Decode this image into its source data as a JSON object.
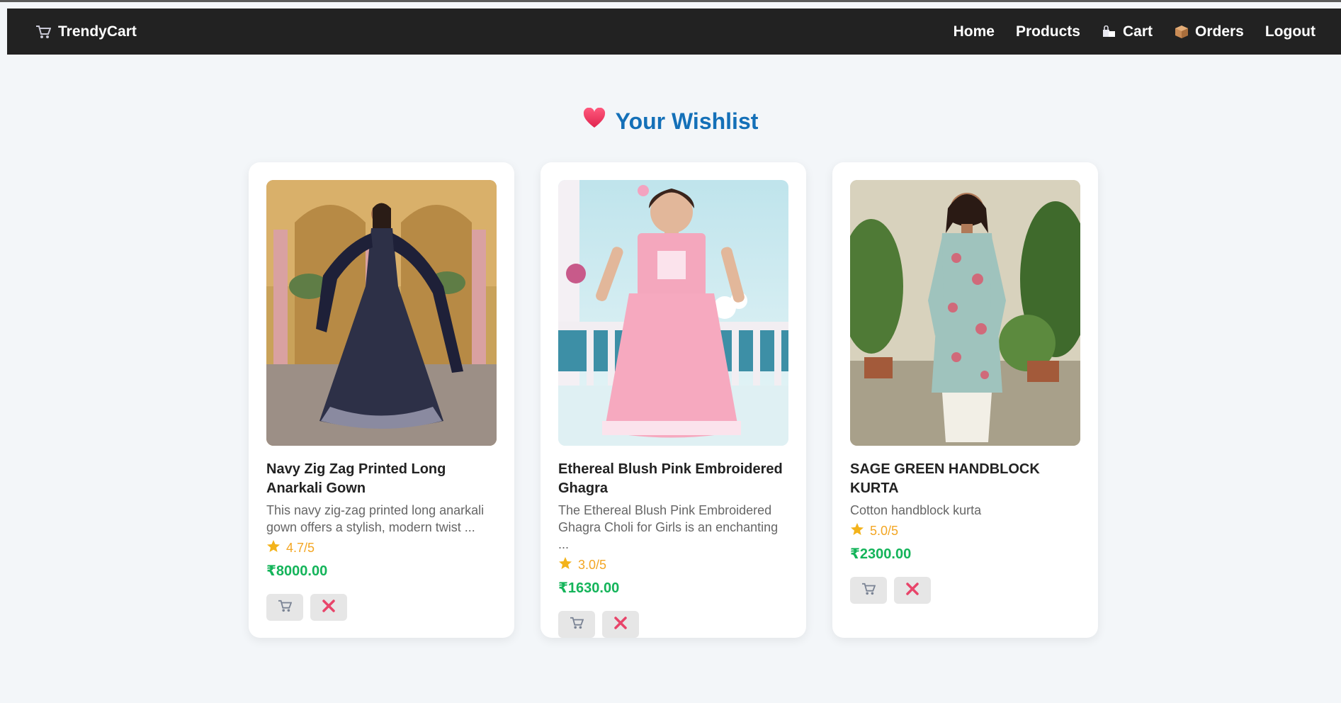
{
  "brand": {
    "name": "TrendyCart",
    "icon": "cart-icon"
  },
  "nav": [
    {
      "label": "Home",
      "icon": ""
    },
    {
      "label": "Products",
      "icon": ""
    },
    {
      "label": "Cart",
      "icon": "shopping-bags-icon"
    },
    {
      "label": "Orders",
      "icon": "package-icon"
    },
    {
      "label": "Logout",
      "icon": ""
    }
  ],
  "page": {
    "title": "Your Wishlist",
    "title_icon": "heart-icon"
  },
  "items": [
    {
      "name": "Navy Zig Zag Printed Long Anarkali Gown",
      "description": "This navy zig-zag printed long anarkali gown offers a stylish, modern twist ...",
      "rating": "4.7/5",
      "price": "₹8000.00",
      "image": "navy-anarkali-gown-photo"
    },
    {
      "name": "Ethereal Blush Pink Embroidered Ghagra",
      "description": "The Ethereal Blush Pink Embroidered Ghagra Choli for Girls is an enchanting ...",
      "rating": "3.0/5",
      "price": "₹1630.00",
      "image": "pink-ghagra-photo"
    },
    {
      "name": "SAGE GREEN HANDBLOCK KURTA",
      "description": "Cotton handblock kurta",
      "rating": "5.0/5",
      "price": "₹2300.00",
      "image": "sage-green-kurta-photo"
    }
  ],
  "colors": {
    "navbar": "#222222",
    "title": "#1470b8",
    "price": "#14b45a",
    "rating": "#f3a623",
    "remove": "#e8456a"
  }
}
